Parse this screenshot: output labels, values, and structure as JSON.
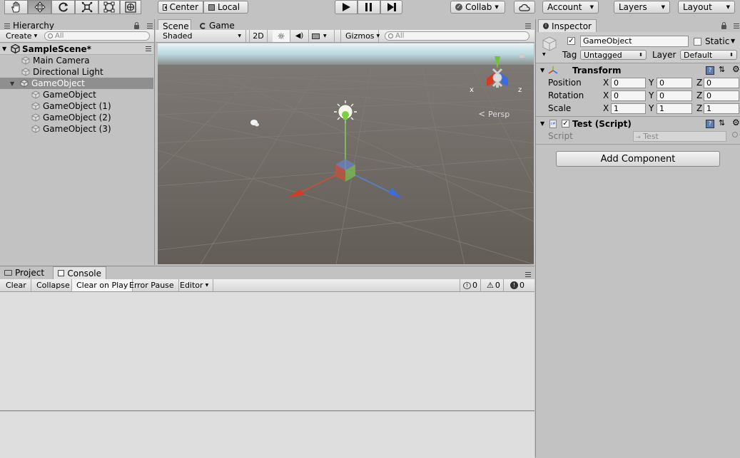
{
  "toolbar": {
    "tools": [
      {
        "name": "hand-tool",
        "icon": "hand-icon"
      },
      {
        "name": "move-tool",
        "icon": "move-icon"
      },
      {
        "name": "rotate-tool",
        "icon": "rotate-icon"
      },
      {
        "name": "scale-tool",
        "icon": "scale-icon"
      },
      {
        "name": "rect-tool",
        "icon": "rect-icon"
      },
      {
        "name": "transform-tool",
        "icon": "transform-icon"
      }
    ],
    "pivot_label": "Center",
    "space_label": "Local",
    "collab_label": "Collab",
    "account_label": "Account",
    "layers_label": "Layers",
    "layout_label": "Layout"
  },
  "hierarchy": {
    "tab_label": "Hierarchy",
    "create_label": "Create",
    "search_placeholder": "All",
    "scene_name": "SampleScene*",
    "items": [
      {
        "label": "Main Camera"
      },
      {
        "label": "Directional Light"
      },
      {
        "label": "GameObject"
      },
      {
        "label": "GameObject"
      },
      {
        "label": "GameObject (1)"
      },
      {
        "label": "GameObject (2)"
      },
      {
        "label": "GameObject (3)"
      }
    ]
  },
  "scene": {
    "tabs": [
      {
        "label": "Scene"
      },
      {
        "label": "Game"
      }
    ],
    "shading_mode": "Shaded",
    "mode_2d": "2D",
    "gizmos_label": "Gizmos",
    "search_placeholder": "All",
    "persp_label": "Persp",
    "axis_x": "x",
    "axis_z": "z",
    "colors": {
      "ground": "#6b6560",
      "sky": "#c9dfe4",
      "x_axis": "#d63a22",
      "y_axis": "#74c23a",
      "z_axis": "#3a6ee0"
    }
  },
  "inspector": {
    "tab_label": "Inspector",
    "object_name": "GameObject",
    "static_label": "Static",
    "tag_label": "Tag",
    "tag_value": "Untagged",
    "layer_label": "Layer",
    "layer_value": "Default",
    "transform": {
      "title": "Transform",
      "rows": [
        {
          "label": "Position",
          "x": "0",
          "y": "0",
          "z": "0"
        },
        {
          "label": "Rotation",
          "x": "0",
          "y": "0",
          "z": "0"
        },
        {
          "label": "Scale",
          "x": "1",
          "y": "1",
          "z": "1"
        }
      ],
      "axis_labels": {
        "x": "X",
        "y": "Y",
        "z": "Z"
      }
    },
    "script_component": {
      "title": "Test (Script)",
      "script_label": "Script",
      "script_value": "Test"
    },
    "add_component_label": "Add Component"
  },
  "bottom": {
    "tabs": [
      {
        "label": "Project"
      },
      {
        "label": "Console"
      }
    ],
    "console_buttons": {
      "clear": "Clear",
      "collapse": "Collapse",
      "clear_on_play": "Clear on Play",
      "error_pause": "Error Pause",
      "editor": "Editor"
    },
    "counts": {
      "info": "0",
      "warning": "0",
      "error": "0"
    }
  }
}
